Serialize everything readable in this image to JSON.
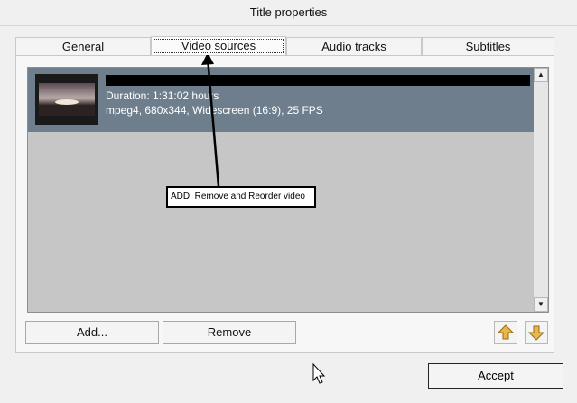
{
  "window": {
    "title": "Title properties"
  },
  "tabs": [
    {
      "label": "General"
    },
    {
      "label": "Video sources"
    },
    {
      "label": "Audio tracks"
    },
    {
      "label": "Subtitles"
    }
  ],
  "video_item": {
    "duration": "Duration: 1:31:02 hours",
    "details": "mpeg4, 680x344, Widescreen (16:9), 25 FPS"
  },
  "annotation": {
    "text": "ADD, Remove and Reorder video"
  },
  "buttons": {
    "add": "Add...",
    "remove": "Remove",
    "accept": "Accept"
  },
  "icons": {
    "move_up": "move-up-arrow-icon",
    "move_down": "move-down-arrow-icon",
    "scroll_up": "scroll-up-icon",
    "scroll_down": "scroll-down-icon",
    "cursor": "mouse-cursor-icon"
  },
  "colors": {
    "selection": "#6f7e8d",
    "list_background": "#c6c6c6",
    "arrow_icon": "#e8b84a"
  }
}
